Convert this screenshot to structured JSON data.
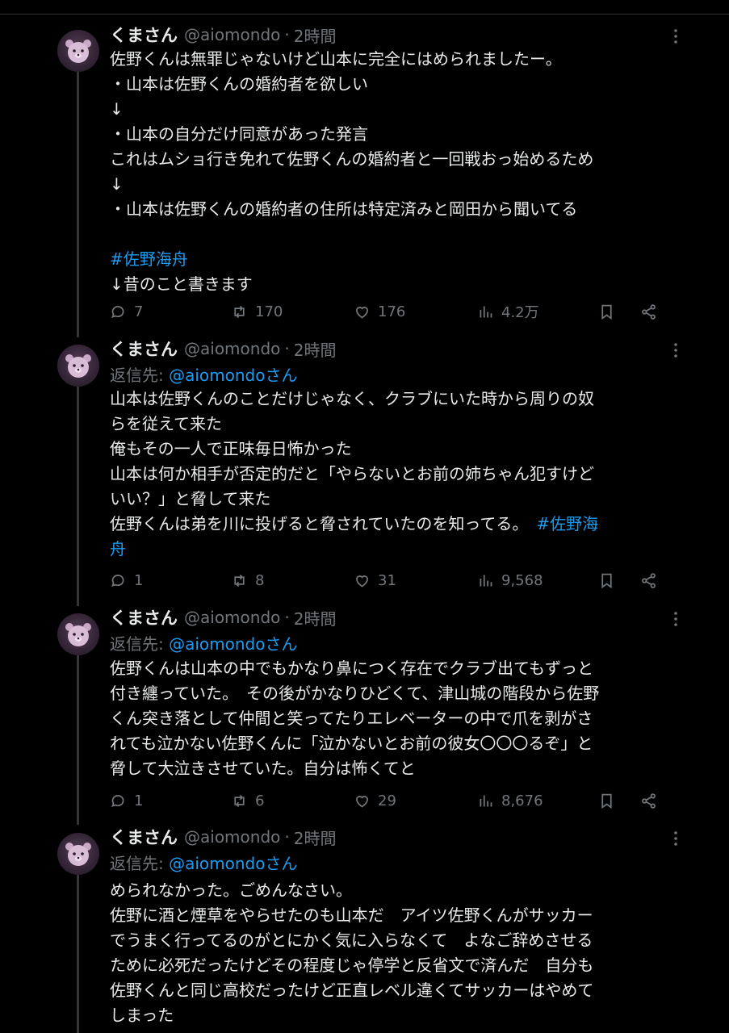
{
  "tweets": [
    {
      "name": "くまさん",
      "handle": "@aiomondo",
      "dot": "·",
      "time": "2時間",
      "reply_label": "",
      "reply_mention": "",
      "lines": [
        "佐野くんは無罪じゃないけど山本に完全にはめられましたー。",
        "・山本は佐野くんの婚約者を欲しい",
        "↓",
        "・山本の自分だけ同意があった発言",
        "これはムショ行き免れて佐野くんの婚約者と一回戦おっ始めるため",
        "↓",
        "・山本は佐野くんの婚約者の住所は特定済みと岡田から聞いてる",
        "",
        "#佐野海舟",
        "↓昔のこと書きます"
      ],
      "stats": {
        "replies": "7",
        "retweets": "170",
        "likes": "176",
        "views": "4.2万"
      }
    },
    {
      "name": "くまさん",
      "handle": "@aiomondo",
      "dot": "·",
      "time": "2時間",
      "reply_label": "返信先: ",
      "reply_mention": "@aiomondoさん",
      "lines": [
        "山本は佐野くんのことだけじゃなく、クラブにいた時から周りの奴",
        "らを従えて来た",
        "俺もその一人で正味毎日怖かった",
        "山本は何か相手が否定的だと「やらないとお前の姉ちゃん犯すけど",
        "いい？」と脅して来た",
        "佐野くんは弟を川に投げると脅されていたのを知ってる。　#佐野海",
        "舟"
      ],
      "stats": {
        "replies": "1",
        "retweets": "8",
        "likes": "31",
        "views": "9,568"
      }
    },
    {
      "name": "くまさん",
      "handle": "@aiomondo",
      "dot": "·",
      "time": "2時間",
      "reply_label": "返信先: ",
      "reply_mention": "@aiomondoさん",
      "lines": [
        "佐野くんは山本の中でもかなり鼻につく存在でクラブ出てもずっと",
        "付き纏っていた。　その後がかなりひどくて、津山城の階段から佐野",
        "くん突き落として仲間と笑ってたりエレベーターの中で爪を剥がさ",
        "れても泣かない佐野くんに「泣かないとお前の彼女〇〇〇るぞ」と",
        "脅して大泣きさせていた。自分は怖くてと"
      ],
      "stats": {
        "replies": "1",
        "retweets": "6",
        "likes": "29",
        "views": "8,676"
      }
    },
    {
      "name": "くまさん",
      "handle": "@aiomondo",
      "dot": "·",
      "time": "2時間",
      "reply_label": "返信先: ",
      "reply_mention": "@aiomondoさん",
      "lines": [
        "められなかった。ごめんなさい。",
        "佐野に酒と煙草をやらせたのも山本だ　アイツ佐野くんがサッカー",
        "でうまく行ってるのがとにかく気に入らなくて　よなご辞めさせる",
        "ために必死だったけどその程度じゃ停学と反省文で済んだ　自分も",
        "佐野くんと同じ高校だったけど正直レベル違くてサッカーはやめて",
        "しまった"
      ]
    }
  ],
  "colors": {
    "text": "#e7e9ea",
    "muted": "#71767b",
    "link": "#1d9bf0",
    "line": "#333639"
  }
}
